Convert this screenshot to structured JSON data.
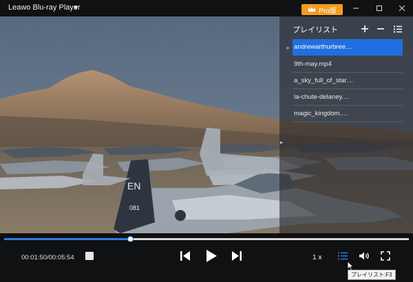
{
  "titlebar": {
    "app_title": "Leawo Blu-ray Player",
    "pro_label": "Pro版",
    "pro_color": "#f39c1f",
    "icons": [
      "chevron-down-icon",
      "crown-icon",
      "minimize-icon",
      "maximize-icon",
      "close-icon"
    ]
  },
  "playlist": {
    "title": "プレイリスト",
    "items": [
      {
        "label": "andrewarthurbree…",
        "active": true
      },
      {
        "label": "9th-may.mp4",
        "active": false
      },
      {
        "label": "a_sky_full_of_star…",
        "active": false
      },
      {
        "label": "la-chute-delaney.…",
        "active": false
      },
      {
        "label": "magic_kingdom.…",
        "active": false
      }
    ],
    "active_color": "#1f6fe0"
  },
  "player": {
    "current_time": "00:01:50",
    "total_time": "00:05:54",
    "time_display": "00:01:50/00:05:54",
    "progress_fraction": 0.311,
    "speed": "1 x",
    "tooltip": "プレイリスト:F3",
    "accent_color": "#2a7de1"
  }
}
